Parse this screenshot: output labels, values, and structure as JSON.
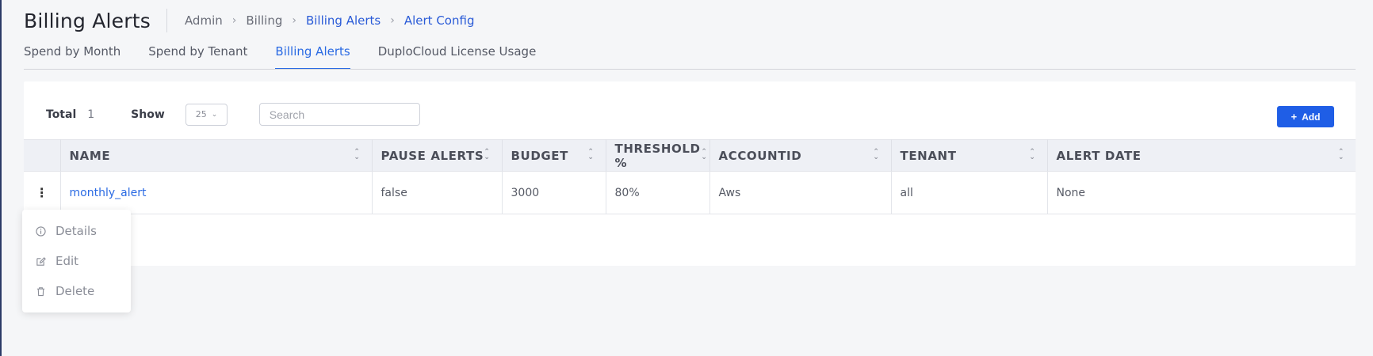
{
  "header": {
    "title": "Billing Alerts",
    "breadcrumbs": [
      "Admin",
      "Billing",
      "Billing Alerts",
      "Alert Config"
    ]
  },
  "tabs": [
    {
      "label": "Spend by Month",
      "active": false
    },
    {
      "label": "Spend by Tenant",
      "active": false
    },
    {
      "label": "Billing Alerts",
      "active": true
    },
    {
      "label": "DuploCloud License Usage",
      "active": false
    }
  ],
  "toolbar": {
    "total_label": "Total",
    "total_value": "1",
    "show_label": "Show",
    "page_size": "25",
    "search_placeholder": "Search",
    "add_label": "Add"
  },
  "table": {
    "columns": [
      "NAME",
      "PAUSE ALERTS",
      "BUDGET",
      "THRESHOLD %",
      "ACCOUNTID",
      "TENANT",
      "ALERT DATE"
    ],
    "rows": [
      {
        "name": "monthly_alert",
        "pause_alerts": "false",
        "budget": "3000",
        "threshold": "80%",
        "accountid": "Aws",
        "tenant": "all",
        "alert_date": "None"
      }
    ]
  },
  "row_menu": {
    "items": [
      {
        "label": "Details",
        "icon": "info-icon"
      },
      {
        "label": "Edit",
        "icon": "edit-icon"
      },
      {
        "label": "Delete",
        "icon": "trash-icon"
      }
    ]
  },
  "colors": {
    "accent": "#2a6ae3",
    "button": "#1f5ee6"
  }
}
